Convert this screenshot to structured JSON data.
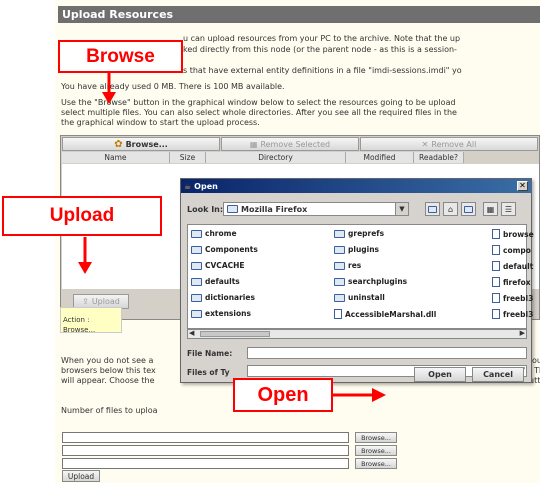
{
  "header": {
    "title": "Upload Resources"
  },
  "intro": {
    "line1": "u can upload resources from your PC to the archive. Note that the up",
    "line2": "ked directly from this node (or the parent node - as this is a session-",
    "line3": "s that have external entity definitions in a file \"imdi-sessions.imdi\" yo",
    "line4": "You have already used 0 MB. There is 100 MB available.",
    "line5": "Use the \"Browse\" button in the graphical window below to select the resources going to be upload",
    "line6": "select multiple files. You can also select whole directories. After you see all the required files in the",
    "line7": "the graphical window to start the upload process."
  },
  "applet": {
    "browse_label": "Browse...",
    "remove_selected_label": "Remove Selected",
    "remove_all_label": "Remove All",
    "columns": [
      "Name",
      "Size",
      "Directory",
      "Modified",
      "Readable?"
    ],
    "upload_label": "Upload",
    "status_line1": "Action : Browse..."
  },
  "dialog": {
    "title": "Open",
    "lookin_label": "Look In:",
    "lookin_value": "Mozilla Firefox",
    "files": [
      {
        "name": "chrome",
        "type": "folder"
      },
      {
        "name": "Components",
        "type": "folder"
      },
      {
        "name": "CVCACHE",
        "type": "folder"
      },
      {
        "name": "defaults",
        "type": "folder"
      },
      {
        "name": "dictionaries",
        "type": "folder"
      },
      {
        "name": "extensions",
        "type": "folder"
      },
      {
        "name": "greprefs",
        "type": "folder"
      },
      {
        "name": "plugins",
        "type": "folder"
      },
      {
        "name": "res",
        "type": "folder"
      },
      {
        "name": "searchplugins",
        "type": "folder"
      },
      {
        "name": "uninstall",
        "type": "folder"
      },
      {
        "name": "AccessibleMarshal.dll",
        "type": "file"
      },
      {
        "name": "browse",
        "type": "file"
      },
      {
        "name": "compo",
        "type": "file"
      },
      {
        "name": "default",
        "type": "file"
      },
      {
        "name": "firefox",
        "type": "file"
      },
      {
        "name": "freebl3",
        "type": "file"
      },
      {
        "name": "freebl3",
        "type": "file"
      }
    ],
    "filename_label": "File Name:",
    "filetype_label": "Files of Ty",
    "open_label": "Open",
    "cancel_label": "Cancel"
  },
  "lower": {
    "line1": "When you do not see a",
    "line2": "browsers below this tex",
    "line3": "will appear. Choose the",
    "right1": "ou",
    "right2": ". Th",
    "right3": "utt",
    "count_label": "Number of files to uploa",
    "browse_labels": [
      "Browse...",
      "Browse...",
      "Browse..."
    ],
    "upload_label": "Upload"
  },
  "callouts": {
    "browse": "Browse",
    "upload": "Upload",
    "open": "Open"
  },
  "colors": {
    "callout": "#ff0000",
    "header_bg": "#6f6f6f",
    "page_bg": "#fffdf0"
  }
}
